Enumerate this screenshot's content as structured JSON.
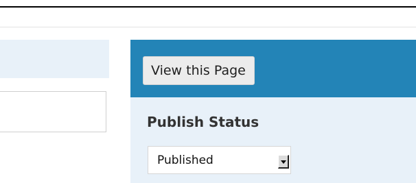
{
  "page_actions": {
    "view_page_label": "View this Page"
  },
  "publish_status": {
    "heading": "Publish Status",
    "selected": "Published"
  },
  "colors": {
    "panel_header": "#2384b7",
    "panel_background": "#e8f1f9"
  },
  "icons": {
    "select_arrow": "chevron-down-icon"
  }
}
